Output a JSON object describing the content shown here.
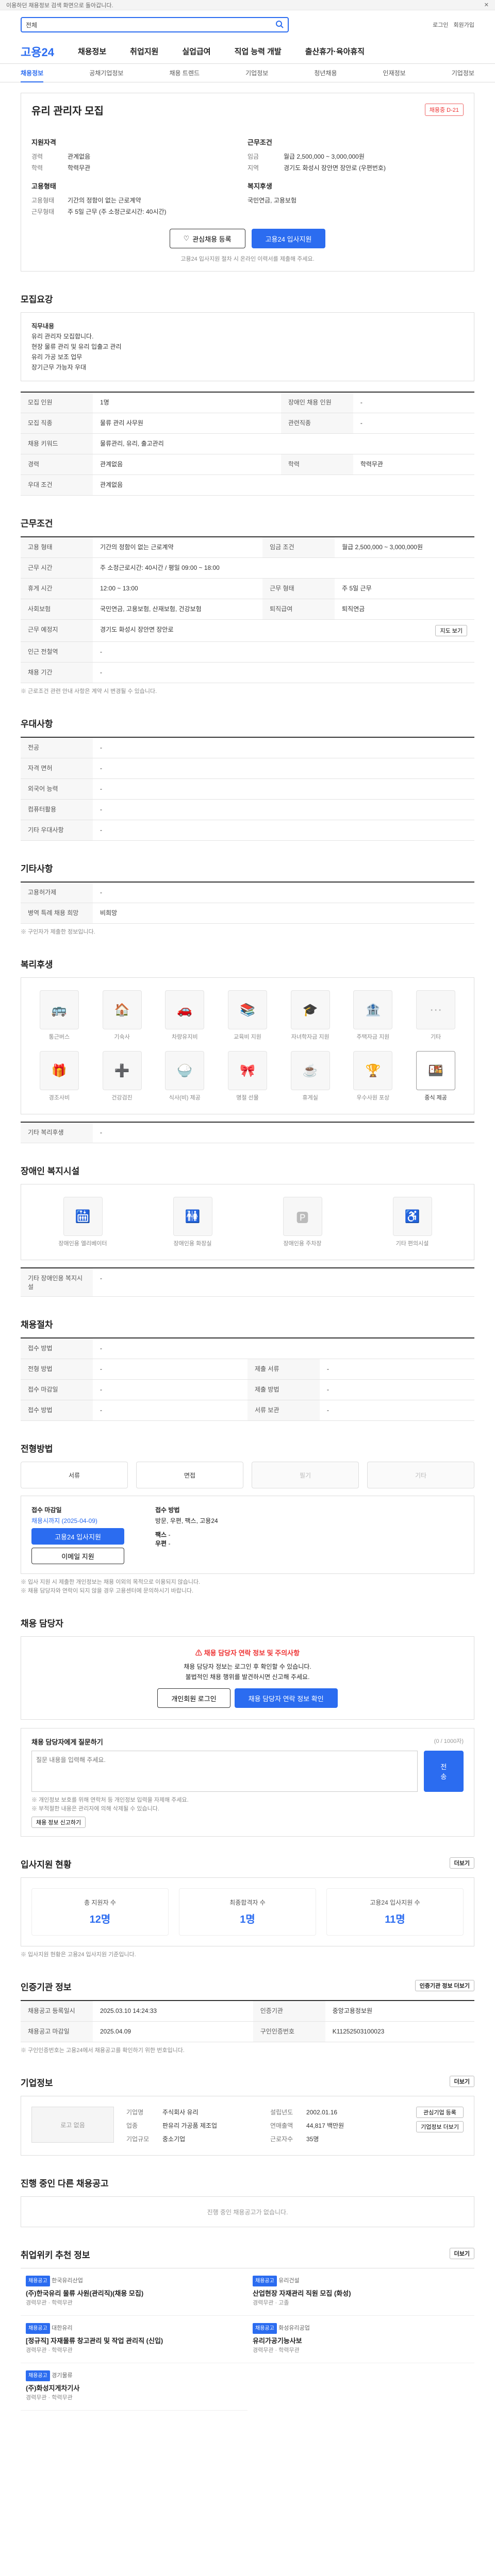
{
  "topbar": {
    "text": "이용하던 채용정보 검색 화면으로 돌아갑니다.",
    "close": "✕"
  },
  "search": {
    "scope": "전체",
    "placeholder": "",
    "links": [
      "로그인",
      "회원가입"
    ]
  },
  "gnb": {
    "logo": "고용24",
    "menus": [
      "채용정보",
      "취업지원",
      "실업급여",
      "직업 능력 개발",
      "출산휴가·육아휴직"
    ]
  },
  "subnav": {
    "items": [
      "채용정보",
      "공채기업정보",
      "채용 트렌드",
      "기업정보",
      "청년채용",
      "인재정보",
      "기업정보"
    ],
    "active_index": 0
  },
  "job": {
    "title": "유리 관리자 모집",
    "badge": "채용중 D-21",
    "applicant_heading": "지원자격",
    "applicant": [
      {
        "k": "경력",
        "v": "관계없음"
      },
      {
        "k": "학력",
        "v": "학력무관"
      }
    ],
    "conditions_heading": "근무조건",
    "conditions": [
      {
        "k": "임금",
        "v": "월급 2,500,000 ~ 3,000,000원"
      },
      {
        "k": "지역",
        "v": "경기도 화성시 장안면 장안로 (우편번호)"
      }
    ],
    "employ_heading": "고용형태",
    "employ": [
      {
        "k": "고용형태",
        "v": "기간의 정함이 없는 근로계약"
      },
      {
        "k": "근무형태",
        "v": "주 5일 근무 (주 소정근로시간: 40시간)"
      }
    ],
    "welfare_heading": "복지후생",
    "welfare": [
      {
        "k": "",
        "v": "국민연금, 고용보험"
      }
    ],
    "scrap_label": "관심채용 등록",
    "apply_label": "고용24 입사지원",
    "notice": "고용24 입사지원 절차 시 온라인 이력서를 제출해 주세요."
  },
  "sections": {
    "job_desc": {
      "heading": "모집요강",
      "body": [
        "직무내용",
        "유리 관리자 모집합니다.",
        "현장 물류 관리 및 유리 입출고 관리",
        "유리 가공 보조 업무",
        "장기근무 가능자 우대"
      ]
    },
    "recruit_table": [
      {
        "k": "모집 인원",
        "v": "1명",
        "k2": "장애인 채용 인원",
        "v2": "-"
      },
      {
        "k": "모집 직종",
        "v": "물류 관리 사무원",
        "k2": "관련직종",
        "v2": "-"
      },
      {
        "k": "채용 키워드",
        "v": "물류관리, 유리, 출고관리",
        "k2": "",
        "v2": ""
      },
      {
        "k": "경력",
        "v": "관계없음",
        "k2": "학력",
        "v2": "학력무관"
      },
      {
        "k": "우대 조건",
        "v": "관계없음",
        "k2": "",
        "v2": ""
      }
    ],
    "work_heading": "근무조건",
    "work_table": [
      {
        "k": "고용 형태",
        "v": "기간의 정함이 없는 근로계약",
        "k2": "임금 조건",
        "v2": "월급 2,500,000 ~ 3,000,000원"
      },
      {
        "k": "근무 시간",
        "v": "주 소정근로시간: 40시간 / 평일 09:00 ~ 18:00",
        "k2": "",
        "v2": ""
      },
      {
        "k": "휴게 시간",
        "v": "12:00 ~ 13:00",
        "k2": "근무 형태",
        "v2": "주 5일 근무"
      },
      {
        "k": "사회보험",
        "v": "국민연금, 고용보험, 산재보험, 건강보험",
        "k2": "퇴직급여",
        "v2": "퇴직연금"
      },
      {
        "k": "근무 예정지",
        "v": "경기도 화성시 장안면 장안로",
        "k2": "",
        "v2": ""
      },
      {
        "k": "인근 전철역",
        "v": "-",
        "k2": "",
        "v2": ""
      },
      {
        "k": "채용 기간",
        "v": "-",
        "k2": "",
        "v2": ""
      }
    ],
    "work_note": "※ 근로조건 관련 안내 사항은 계약 시 변경될 수 있습니다.",
    "map_btn": "지도 보기",
    "etc_heading": "우대사항",
    "etc_table": [
      {
        "k": "전공",
        "v": "-"
      },
      {
        "k": "자격 면허",
        "v": "-"
      },
      {
        "k": "외국어 능력",
        "v": "-"
      },
      {
        "k": "컴퓨터활용",
        "v": "-"
      },
      {
        "k": "기타 우대사항",
        "v": "-"
      }
    ],
    "other_heading": "기타사항",
    "other_table": [
      {
        "k": "고용허가제",
        "v": "-"
      },
      {
        "k": "병역 특례 채용 희망",
        "v": "비희망"
      }
    ],
    "other_note": "※ 구인자가 제출한 정보입니다.",
    "welfare_heading": "복리후생",
    "welfare_icons": [
      "통근버스",
      "기숙사",
      "차량유지비",
      "교육비 지원",
      "자녀학자금 지원",
      "주택자금 지원",
      "기타",
      "경조사비",
      "건강검진",
      "식사(비) 제공",
      "명절 선물",
      "휴게실",
      "우수사원 포상",
      "중식 제공"
    ],
    "welfare_on": [
      13
    ],
    "welfare_other_label": "기타 복리후생",
    "welfare_other_value": "-",
    "disability_heading": "장애인 복지시설",
    "disability_icons": [
      "장애인용 엘리베이터",
      "장애인용 화장실",
      "장애인용 주차장",
      "기타 편의시설"
    ],
    "disability_other_label": "기타 장애인용 복지시설",
    "disability_other_value": "-",
    "process_heading": "채용절차",
    "process_table": [
      {
        "k": "접수 방법",
        "v": "-",
        "k2": "",
        "v2": ""
      },
      {
        "k": "전형 방법",
        "v": "-",
        "k2": "제출 서류",
        "v2": "-"
      },
      {
        "k": "접수 마감일",
        "v": "-",
        "k2": "제출 방법",
        "v2": "-"
      },
      {
        "k": "접수 방법",
        "v": "-",
        "k2": "서류 보관",
        "v2": "-"
      }
    ],
    "apply_method_heading": "전형방법",
    "apply_methods": [
      {
        "label": "서류",
        "off": false
      },
      {
        "label": "면접",
        "off": false
      },
      {
        "label": "필기",
        "off": true
      },
      {
        "label": "기타",
        "off": true
      }
    ],
    "apply_info": {
      "left_title": "접수 마감일",
      "left_value": "채용시까지 (2025-04-09)",
      "right_title": "접수 방법",
      "right_lines": [
        "방문, 우편, 팩스, 고용24"
      ],
      "apply_btn": "고용24 입사지원",
      "email_btn": "이메일 지원",
      "fax_label": "팩스",
      "fax_value": "-",
      "post_label": "우편",
      "post_value": "-"
    },
    "apply_notes": [
      "※ 입사 지원 시 제출한 개인정보는 채용 이외의 목적으로 이용되지 않습니다.",
      "※ 채용 담당자와 연락이 되지 않을 경우 고용센터에 문의하시기 바랍니다."
    ],
    "manager_heading": "채용 담당자",
    "warn_title": "채용 담당자 연락 정보 및 주의사항",
    "warn_lines": [
      "채용 담당자 정보는 로그인 후 확인할 수 있습니다.",
      "불법적인 채용 행위를 발견하시면 신고해 주세요."
    ],
    "warn_btn1": "개인회원 로그인",
    "warn_btn2": "채용 담당자 연락 정보 확인",
    "qa_title": "채용 담당자에게 질문하기",
    "qa_hint": "(0 / 1000자)",
    "qa_placeholder": "질문 내용을 입력해 주세요.",
    "qa_btn": "전송",
    "qa_notes": [
      "※ 개인정보 보호를 위해 연락처 등 개인정보 입력을 자제해 주세요.",
      "※ 부적절한 내용은 관리자에 의해 삭제될 수 있습니다."
    ],
    "qa_report": "채용 정보 신고하기",
    "stats_heading": "입사지원 현황",
    "stats_more": "더보기",
    "stats": [
      {
        "label": "총 지원자 수",
        "value": "12명"
      },
      {
        "label": "최종합격자 수",
        "value": "1명"
      },
      {
        "label": "고용24 입사지원 수",
        "value": "11명"
      }
    ],
    "stats_note": "※ 입사지원 현황은 고용24 입사지원 기준입니다.",
    "info_heading": "인증기관 정보",
    "info_btn": "인증기관 정보 더보기",
    "info_table": [
      {
        "k": "채용공고 등록일시",
        "v": "2025.03.10 14:24:33",
        "k2": "인증기관",
        "v2": "중앙고용정보원"
      },
      {
        "k": "채용공고 마감일",
        "v": "2025.04.09",
        "k2": "구인인증번호",
        "v2": "K11252503100023"
      }
    ],
    "info_notes": [
      "※ 구인인증번호는 고용24에서 채용공고를 확인하기 위한 번호입니다."
    ],
    "company_heading": "기업정보",
    "company_more": "더보기",
    "company_logo": "로고 없음",
    "company": [
      {
        "k": "기업명",
        "v": "주식회사 유리"
      },
      {
        "k": "업종",
        "v": "판유리 가공품 제조업"
      },
      {
        "k": "기업규모",
        "v": "중소기업"
      },
      {
        "k": "설립년도",
        "v": "2002.01.16"
      },
      {
        "k": "연매출액",
        "v": "44,817 백만원"
      },
      {
        "k": "근로자수",
        "v": "35명"
      }
    ],
    "company_btns": [
      "관심기업 등록",
      "기업정보 더보기"
    ],
    "same_heading": "진행 중인 다른 채용공고",
    "same_empty": "진행 중인 채용공고가 없습니다.",
    "rec_heading": "취업위키 추천 정보",
    "rec_more": "더보기",
    "recommend": [
      {
        "tag": "채용공고",
        "company": "한국유리산업",
        "title": "(주)한국유리 물류 사원(관리직)(채용 모집)",
        "meta": "경력무관 · 학력무관"
      },
      {
        "tag": "채용공고",
        "company": "유리건설",
        "title": "산업현장 자재관리 직원 모집 (화성)",
        "meta": "경력무관 · 고졸"
      },
      {
        "tag": "채용공고",
        "company": "대한유리",
        "title": "[정규직] 자재물류 창고관리 및 작업 관리직 (신입)",
        "meta": "경력무관 · 학력무관"
      },
      {
        "tag": "채용공고",
        "company": "화성유리공업",
        "title": "유리가공기능사보",
        "meta": "경력무관 · 학력무관"
      },
      {
        "tag": "채용공고",
        "company": "경기물류",
        "title": "(주)화성지게차기사",
        "meta": "경력무관 · 학력무관"
      }
    ]
  }
}
